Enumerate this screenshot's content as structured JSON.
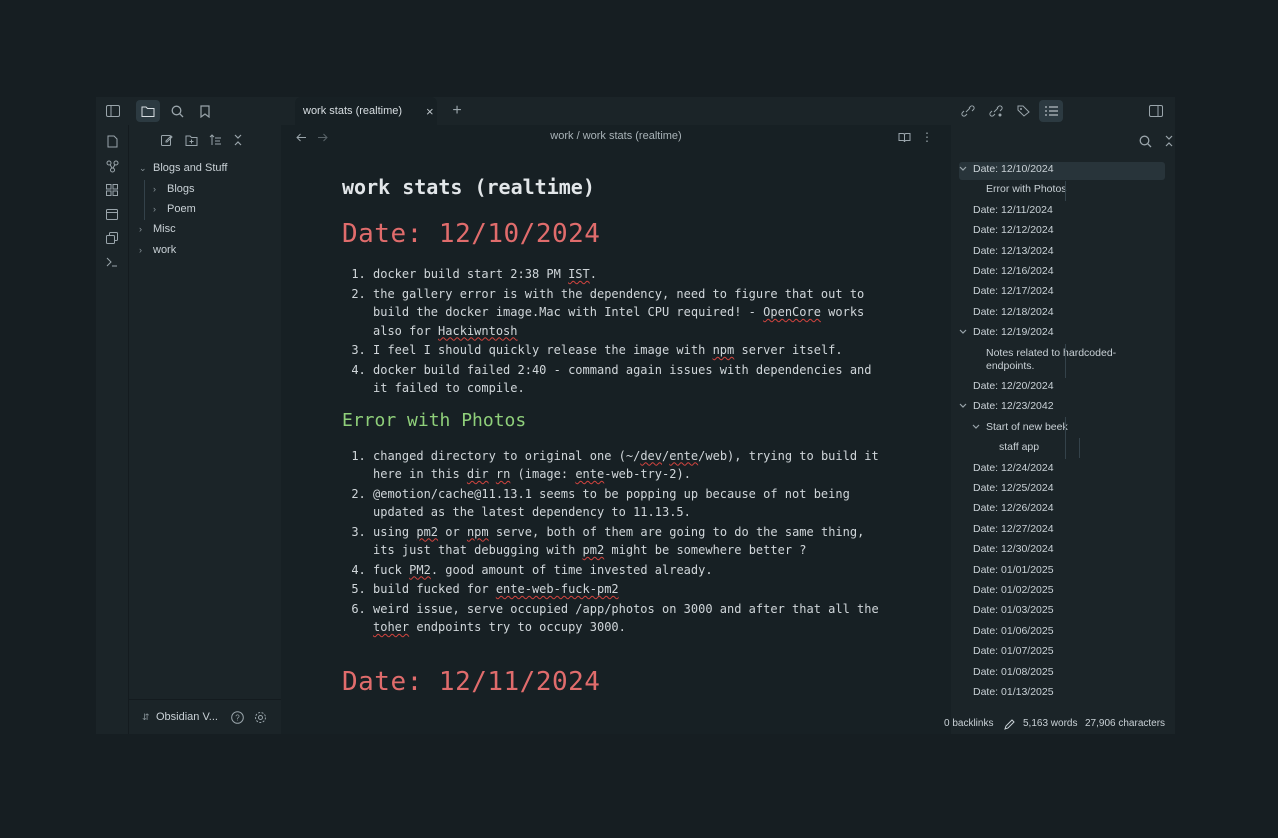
{
  "tab": {
    "title": "work stats (realtime)"
  },
  "breadcrumb": {
    "folder": "work",
    "separator": "/",
    "note": "work stats (realtime)"
  },
  "sidebar": {
    "tree": [
      {
        "label": "Blogs and Stuff",
        "expanded": true,
        "children": [
          {
            "label": "Blogs"
          },
          {
            "label": "Poem"
          }
        ]
      },
      {
        "label": "Misc"
      },
      {
        "label": "work"
      }
    ],
    "vault_name": "Obsidian V..."
  },
  "note": {
    "title": "work stats (realtime)",
    "sections": [
      {
        "heading": "Date: 12/10/2024",
        "items": [
          "docker build start 2:38 PM IST.",
          "the gallery error is with the dependency, need to figure that out to build the docker image.Mac with Intel CPU required! - OpenCore works also for Hackiwntosh",
          "I feel I should quickly release the image with npm server itself.",
          "docker build failed 2:40 - command again issues with dependencies and it failed to compile."
        ]
      },
      {
        "subheading": "Error with Photos",
        "items": [
          "changed directory to original one (~/dev/ente/web), trying to build it here in this dir rn (image: ente-web-try-2).",
          "@emotion/cache@11.13.1 seems to be popping up because of not being updated as the latest dependency to 11.13.5.",
          "using pm2 or npm serve, both of them are going to do the same thing, its just that debugging with pm2 might be somewhere better ?",
          "fuck PM2. good amount of time invested already.",
          "build fucked for ente-web-fuck-pm2",
          "weird issue, serve occupied /app/photos on 3000 and after that all the toher endpoints try to occupy 3000."
        ]
      },
      {
        "heading": "Date: 12/11/2024"
      }
    ]
  },
  "outline": [
    {
      "label": "Date: 12/10/2024",
      "level": 1,
      "collapsible": true,
      "selected": true
    },
    {
      "label": "Error with Photos",
      "level": 2
    },
    {
      "label": "Date: 12/11/2024",
      "level": 1
    },
    {
      "label": "Date: 12/12/2024",
      "level": 1
    },
    {
      "label": "Date: 12/13/2024",
      "level": 1
    },
    {
      "label": "Date: 12/16/2024",
      "level": 1
    },
    {
      "label": "Date: 12/17/2024",
      "level": 1
    },
    {
      "label": "Date: 12/18/2024",
      "level": 1
    },
    {
      "label": "Date: 12/19/2024",
      "level": 1,
      "collapsible": true
    },
    {
      "label": "Notes related to hardcoded-endpoints.",
      "level": 2
    },
    {
      "label": "Date: 12/20/2024",
      "level": 1
    },
    {
      "label": "Date: 12/23/2042",
      "level": 1,
      "collapsible": true
    },
    {
      "label": "Start of new beek",
      "level": 2,
      "collapsible": true
    },
    {
      "label": "staff app",
      "level": 3
    },
    {
      "label": "Date: 12/24/2024",
      "level": 1
    },
    {
      "label": "Date: 12/25/2024",
      "level": 1
    },
    {
      "label": "Date: 12/26/2024",
      "level": 1
    },
    {
      "label": "Date: 12/27/2024",
      "level": 1
    },
    {
      "label": "Date: 12/30/2024",
      "level": 1
    },
    {
      "label": "Date: 01/01/2025",
      "level": 1
    },
    {
      "label": "Date: 01/02/2025",
      "level": 1
    },
    {
      "label": "Date: 01/03/2025",
      "level": 1
    },
    {
      "label": "Date: 01/06/2025",
      "level": 1
    },
    {
      "label": "Date: 01/07/2025",
      "level": 1
    },
    {
      "label": "Date: 01/08/2025",
      "level": 1
    },
    {
      "label": "Date: 01/13/2025",
      "level": 1
    }
  ],
  "status": {
    "backlinks": "0 backlinks",
    "words": "5,163 words",
    "characters": "27,906 characters"
  },
  "colors": {
    "heading": "#e06c6c",
    "subheading": "#8fcf7a",
    "spellcheck": "#d2443f"
  },
  "icons": {
    "ribbon": [
      "files-icon",
      "graph-icon",
      "blocks-icon",
      "calendar-icon",
      "copy-icon",
      "terminal-icon"
    ],
    "top_left": [
      "sidebar-toggle-icon",
      "folder-icon",
      "search-icon",
      "bookmark-icon"
    ],
    "right_top": [
      "link-icon",
      "link-out-icon",
      "tag-icon",
      "list-icon",
      "right-sidebar-icon"
    ]
  }
}
